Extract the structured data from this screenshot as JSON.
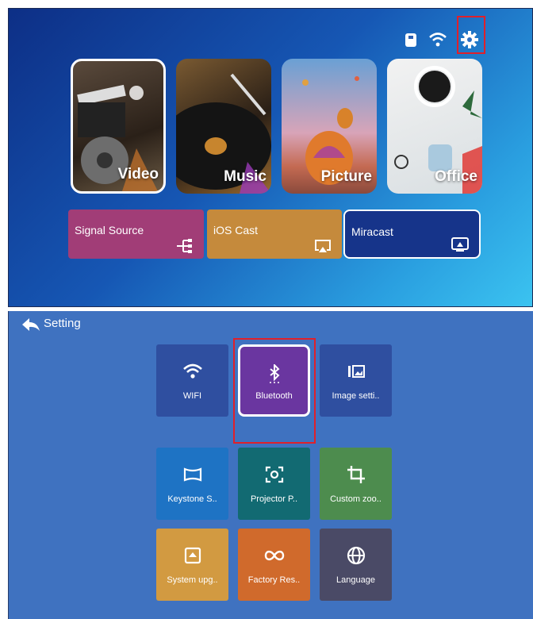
{
  "home": {
    "tiles": [
      {
        "label": "Video",
        "selected": true
      },
      {
        "label": "Music",
        "selected": false
      },
      {
        "label": "Picture",
        "selected": false
      },
      {
        "label": "Office",
        "selected": false
      }
    ],
    "actions": [
      {
        "label": "Signal Source",
        "color": "#a13d77",
        "icon": "signal-source-icon"
      },
      {
        "label": "iOS Cast",
        "color": "#c58a3c",
        "icon": "airplay-icon"
      },
      {
        "label": "Miracast",
        "color": "#16348a",
        "icon": "screen-mirror-icon",
        "selected": true
      }
    ],
    "status_icons": [
      "usb-icon",
      "wifi-icon",
      "gear-icon"
    ]
  },
  "settings": {
    "title": "Setting",
    "tiles": [
      {
        "label": "WIFI",
        "color": "#2f4fa0",
        "icon": "wifi-icon"
      },
      {
        "label": "Bluetooth",
        "color": "#6a36a0",
        "icon": "bluetooth-icon",
        "selected": true
      },
      {
        "label": "Image setti..",
        "color": "#2f4fa0",
        "icon": "image-settings-icon"
      },
      {
        "label": "Keystone S..",
        "color": "#1e73c4",
        "icon": "keystone-icon"
      },
      {
        "label": "Projector P..",
        "color": "#126a72",
        "icon": "projector-position-icon"
      },
      {
        "label": "Custom zoo..",
        "color": "#4d8c4e",
        "icon": "crop-icon"
      },
      {
        "label": "System upg..",
        "color": "#d29a41",
        "icon": "upload-icon"
      },
      {
        "label": "Factory Res..",
        "color": "#d06a2c",
        "icon": "infinity-icon"
      },
      {
        "label": "Language",
        "color": "#4a4a66",
        "icon": "globe-icon"
      }
    ]
  }
}
